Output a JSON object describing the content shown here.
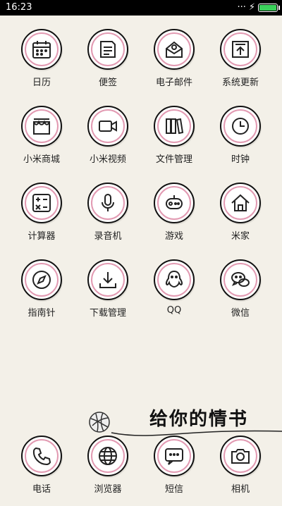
{
  "status": {
    "time": "16:23",
    "battery_level": 0.95
  },
  "apps": [
    {
      "label": "日历",
      "icon": "calendar-icon"
    },
    {
      "label": "便签",
      "icon": "notes-icon"
    },
    {
      "label": "电子邮件",
      "icon": "email-icon"
    },
    {
      "label": "系统更新",
      "icon": "update-icon"
    },
    {
      "label": "小米商城",
      "icon": "store-icon"
    },
    {
      "label": "小米视频",
      "icon": "video-icon"
    },
    {
      "label": "文件管理",
      "icon": "files-icon"
    },
    {
      "label": "时钟",
      "icon": "clock-icon"
    },
    {
      "label": "计算器",
      "icon": "calculator-icon"
    },
    {
      "label": "录音机",
      "icon": "recorder-icon"
    },
    {
      "label": "游戏",
      "icon": "game-icon"
    },
    {
      "label": "米家",
      "icon": "home-icon"
    },
    {
      "label": "指南针",
      "icon": "compass-icon"
    },
    {
      "label": "下载管理",
      "icon": "download-icon"
    },
    {
      "label": "QQ",
      "icon": "qq-icon"
    },
    {
      "label": "微信",
      "icon": "wechat-icon"
    }
  ],
  "decoration": {
    "text": "给你的情书"
  },
  "dock": [
    {
      "label": "电话",
      "icon": "phone-icon"
    },
    {
      "label": "浏览器",
      "icon": "browser-icon"
    },
    {
      "label": "短信",
      "icon": "message-icon"
    },
    {
      "label": "相机",
      "icon": "camera-icon"
    }
  ]
}
